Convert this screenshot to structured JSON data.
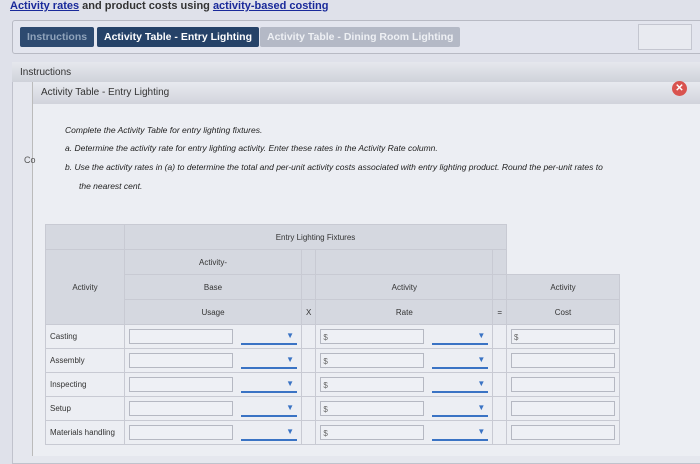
{
  "title": {
    "link1": "Activity rates",
    "middle": " and product costs using ",
    "link2": "activity-based costing"
  },
  "tabs": [
    "Instructions",
    "Activity Table - Entry Lighting",
    "Activity Table - Dining Room Lighting"
  ],
  "panel": {
    "header": "Instructions",
    "subheader": "Activity Table - Entry Lighting",
    "side_text": "Co"
  },
  "instructions": {
    "intro": "Complete the Activity Table for entry lighting fixtures.",
    "a": "a.  Determine the activity rate for entry lighting activity. Enter these rates in the Activity Rate column.",
    "b": "b.  Use the activity rates in (a) to determine the total and per-unit activity costs associated with entry lighting product. Round the per-unit rates to",
    "b2": "the nearest cent."
  },
  "table": {
    "group_header": "Entry Lighting Fixtures",
    "col_activity": "Activity",
    "usage": [
      "Activity-",
      "Base",
      "Usage"
    ],
    "times": "X",
    "rate": [
      "Activity",
      "Rate"
    ],
    "equals": "=",
    "cost": [
      "Activity",
      "Cost"
    ],
    "currency": "$",
    "rows": [
      "Casting",
      "Assembly",
      "Inspecting",
      "Setup",
      "Materials handling"
    ]
  },
  "colors": {
    "tab_active": "#254268",
    "link": "#1a2a9a",
    "dropdown": "#3a73c4",
    "close": "#d9534f"
  }
}
